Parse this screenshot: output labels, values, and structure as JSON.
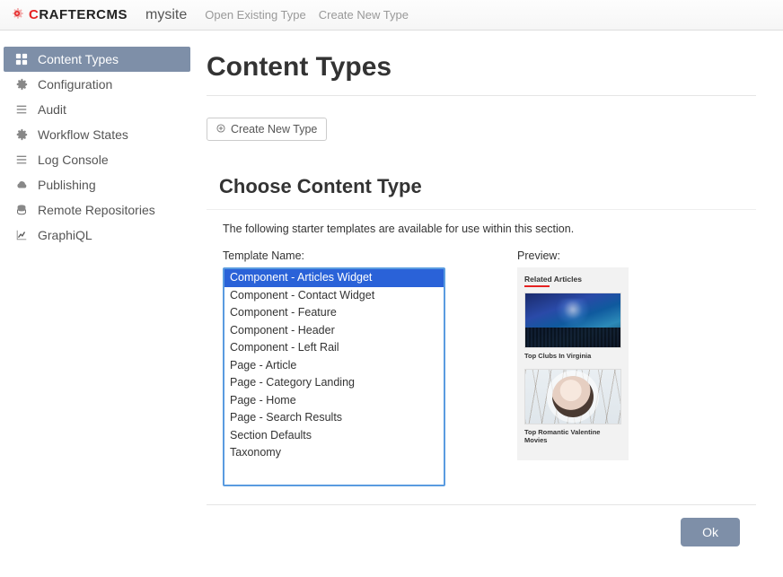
{
  "brand": {
    "part1": "C",
    "part2": "RAFTER",
    "part3": "CMS"
  },
  "site_name": "mysite",
  "top_links": [
    "Open Existing Type",
    "Create New Type"
  ],
  "sidebar": {
    "items": [
      {
        "label": "Content Types",
        "icon": "grid-icon",
        "active": true
      },
      {
        "label": "Configuration",
        "icon": "gear-icon",
        "active": false
      },
      {
        "label": "Audit",
        "icon": "list-icon",
        "active": false
      },
      {
        "label": "Workflow States",
        "icon": "gear-icon",
        "active": false
      },
      {
        "label": "Log Console",
        "icon": "list-icon",
        "active": false
      },
      {
        "label": "Publishing",
        "icon": "cloud-icon",
        "active": false
      },
      {
        "label": "Remote Repositories",
        "icon": "database-icon",
        "active": false
      },
      {
        "label": "GraphiQL",
        "icon": "chart-icon",
        "active": false
      }
    ]
  },
  "page": {
    "title": "Content Types",
    "create_button": "Create New Type"
  },
  "dialog": {
    "title": "Choose Content Type",
    "description": "The following starter templates are available for use within this section.",
    "template_label": "Template Name:",
    "preview_label": "Preview:",
    "templates": [
      "Component - Articles Widget",
      "Component - Contact Widget",
      "Component - Feature",
      "Component - Header",
      "Component - Left Rail",
      "Page - Article",
      "Page - Category Landing",
      "Page - Home",
      "Page - Search Results",
      "Section Defaults",
      "Taxonomy"
    ],
    "selected_index": 0,
    "preview": {
      "heading": "Related Articles",
      "cards": [
        {
          "caption": "Top Clubs In Virginia",
          "img": "concert"
        },
        {
          "caption": "Top Romantic Valentine Movies",
          "img": "couple"
        }
      ]
    },
    "ok_label": "Ok"
  }
}
